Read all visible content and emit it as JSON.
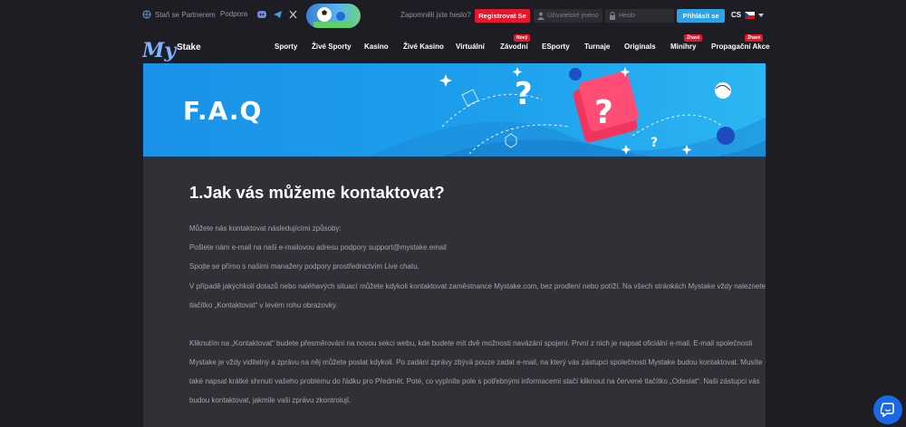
{
  "topbar": {
    "partner": "Staň se Partnerem",
    "support": "Podpora",
    "forgot": "Zapomněli jste heslo?",
    "register": "Registrovat Se",
    "username_placeholder": "Uživatelské jméno",
    "password_placeholder": "Heslo",
    "login": "Přihlásit se",
    "lang": "CS"
  },
  "nav": {
    "logo_my": "My",
    "logo_stake": "Stake",
    "items": [
      {
        "label": "Sporty",
        "badge": ""
      },
      {
        "label": "Živé Sporty",
        "badge": ""
      },
      {
        "label": "Kasino",
        "badge": ""
      },
      {
        "label": "Živé Kasino",
        "badge": ""
      },
      {
        "label": "Virtuální",
        "badge": ""
      },
      {
        "label": "Závodní",
        "badge": "Nový"
      },
      {
        "label": "ESporty",
        "badge": ""
      },
      {
        "label": "Turnaje",
        "badge": ""
      },
      {
        "label": "Originals",
        "badge": ""
      },
      {
        "label": "Minihry",
        "badge": "Žhavé"
      },
      {
        "label": "Propagační Akce",
        "badge": "Žhavé"
      }
    ]
  },
  "banner": {
    "title": "F.A.Q"
  },
  "content": {
    "heading": "1.Jak vás můžeme kontaktovat?",
    "paragraphs": [
      "Můžete nás kontaktovat následujícími způsoby:",
      "Pošlete nám e-mail na naši e-mailovou adresu podpory support@mystake.email",
      "Spojte se přímo s našimi manažery podpory prostřednictvím Live chatu.",
      "V případě jakýchkoli dotazů nebo naléhavých situací můžete kdykoli kontaktovat zaměstnance Mystake.com, bez prodlení nebo potíží. Na všech stránkách Mystake vždy naleznete",
      "tlačítko „Kontaktovat“ v levém rohu obrazovky.",
      "Kliknutím na „Kontaktovat“ budete přesměrováni na novou sekci webu, kde budete mít dvě možnosti navázání spojení. První z nich je napsat oficiální e-mail. E-mail společnosti",
      "Mystake je vždy viditelný a zprávu na něj můžete poslat kdykoli. Po zadání zprávy zbývá pouze zadat e-mail, na který vás zástupci společnosti Mystake budou kontaktovat. Musíte",
      "také napsat krátké shrnutí vašeho problému do řádku pro Předmět. Poté, co vyplníte pole s potřebnými informacemi stačí kliknout na červené tlačítko „Odeslat“. Naši zástupci vás",
      "budou kontaktovat, jakmile vaši zprávu zkontrolují."
    ]
  },
  "colors": {
    "accent": "#2ba3e6",
    "register": "#e5172a",
    "banner": "#1a92e8"
  }
}
